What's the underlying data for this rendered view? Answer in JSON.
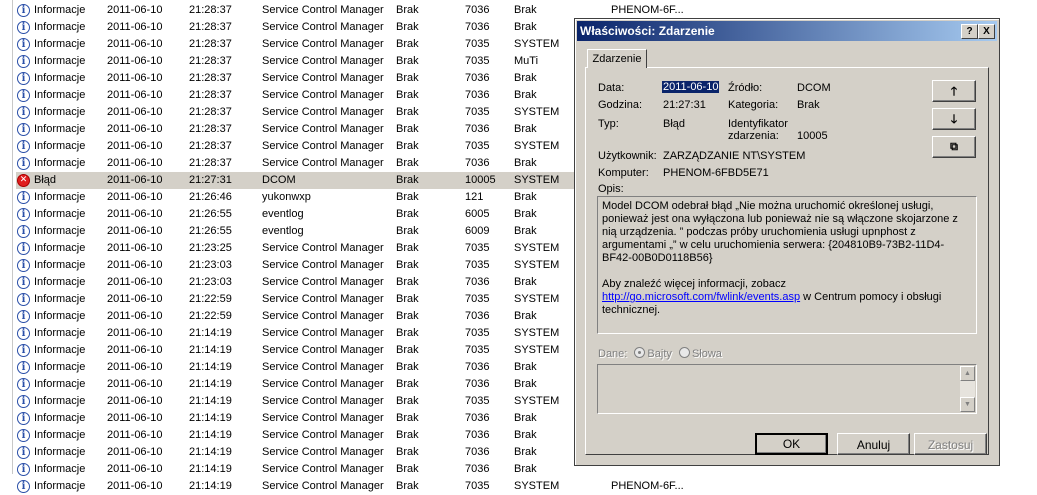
{
  "events": [
    {
      "type": "Informacje",
      "date": "2011-06-10",
      "time": "21:28:37",
      "source": "Service Control Manager",
      "category": "Brak",
      "id": "7036",
      "user": "Brak",
      "computer": "PHENOM-6F...",
      "kind": "info"
    },
    {
      "type": "Informacje",
      "date": "2011-06-10",
      "time": "21:28:37",
      "source": "Service Control Manager",
      "category": "Brak",
      "id": "7036",
      "user": "Brak",
      "computer": "",
      "kind": "info"
    },
    {
      "type": "Informacje",
      "date": "2011-06-10",
      "time": "21:28:37",
      "source": "Service Control Manager",
      "category": "Brak",
      "id": "7035",
      "user": "SYSTEM",
      "computer": "",
      "kind": "info"
    },
    {
      "type": "Informacje",
      "date": "2011-06-10",
      "time": "21:28:37",
      "source": "Service Control Manager",
      "category": "Brak",
      "id": "7035",
      "user": "MuTi",
      "computer": "",
      "kind": "info"
    },
    {
      "type": "Informacje",
      "date": "2011-06-10",
      "time": "21:28:37",
      "source": "Service Control Manager",
      "category": "Brak",
      "id": "7036",
      "user": "Brak",
      "computer": "",
      "kind": "info"
    },
    {
      "type": "Informacje",
      "date": "2011-06-10",
      "time": "21:28:37",
      "source": "Service Control Manager",
      "category": "Brak",
      "id": "7036",
      "user": "Brak",
      "computer": "",
      "kind": "info"
    },
    {
      "type": "Informacje",
      "date": "2011-06-10",
      "time": "21:28:37",
      "source": "Service Control Manager",
      "category": "Brak",
      "id": "7035",
      "user": "SYSTEM",
      "computer": "",
      "kind": "info"
    },
    {
      "type": "Informacje",
      "date": "2011-06-10",
      "time": "21:28:37",
      "source": "Service Control Manager",
      "category": "Brak",
      "id": "7036",
      "user": "Brak",
      "computer": "",
      "kind": "info"
    },
    {
      "type": "Informacje",
      "date": "2011-06-10",
      "time": "21:28:37",
      "source": "Service Control Manager",
      "category": "Brak",
      "id": "7035",
      "user": "SYSTEM",
      "computer": "",
      "kind": "info"
    },
    {
      "type": "Informacje",
      "date": "2011-06-10",
      "time": "21:28:37",
      "source": "Service Control Manager",
      "category": "Brak",
      "id": "7036",
      "user": "Brak",
      "computer": "",
      "kind": "info"
    },
    {
      "type": "Błąd",
      "date": "2011-06-10",
      "time": "21:27:31",
      "source": "DCOM",
      "category": "Brak",
      "id": "10005",
      "user": "SYSTEM",
      "computer": "",
      "kind": "err"
    },
    {
      "type": "Informacje",
      "date": "2011-06-10",
      "time": "21:26:46",
      "source": "yukonwxp",
      "category": "Brak",
      "id": "121",
      "user": "Brak",
      "computer": "",
      "kind": "info"
    },
    {
      "type": "Informacje",
      "date": "2011-06-10",
      "time": "21:26:55",
      "source": "eventlog",
      "category": "Brak",
      "id": "6005",
      "user": "Brak",
      "computer": "",
      "kind": "info"
    },
    {
      "type": "Informacje",
      "date": "2011-06-10",
      "time": "21:26:55",
      "source": "eventlog",
      "category": "Brak",
      "id": "6009",
      "user": "Brak",
      "computer": "",
      "kind": "info"
    },
    {
      "type": "Informacje",
      "date": "2011-06-10",
      "time": "21:23:25",
      "source": "Service Control Manager",
      "category": "Brak",
      "id": "7035",
      "user": "SYSTEM",
      "computer": "",
      "kind": "info"
    },
    {
      "type": "Informacje",
      "date": "2011-06-10",
      "time": "21:23:03",
      "source": "Service Control Manager",
      "category": "Brak",
      "id": "7035",
      "user": "SYSTEM",
      "computer": "",
      "kind": "info"
    },
    {
      "type": "Informacje",
      "date": "2011-06-10",
      "time": "21:23:03",
      "source": "Service Control Manager",
      "category": "Brak",
      "id": "7036",
      "user": "Brak",
      "computer": "",
      "kind": "info"
    },
    {
      "type": "Informacje",
      "date": "2011-06-10",
      "time": "21:22:59",
      "source": "Service Control Manager",
      "category": "Brak",
      "id": "7035",
      "user": "SYSTEM",
      "computer": "",
      "kind": "info"
    },
    {
      "type": "Informacje",
      "date": "2011-06-10",
      "time": "21:22:59",
      "source": "Service Control Manager",
      "category": "Brak",
      "id": "7036",
      "user": "Brak",
      "computer": "",
      "kind": "info"
    },
    {
      "type": "Informacje",
      "date": "2011-06-10",
      "time": "21:14:19",
      "source": "Service Control Manager",
      "category": "Brak",
      "id": "7035",
      "user": "SYSTEM",
      "computer": "",
      "kind": "info"
    },
    {
      "type": "Informacje",
      "date": "2011-06-10",
      "time": "21:14:19",
      "source": "Service Control Manager",
      "category": "Brak",
      "id": "7035",
      "user": "SYSTEM",
      "computer": "",
      "kind": "info"
    },
    {
      "type": "Informacje",
      "date": "2011-06-10",
      "time": "21:14:19",
      "source": "Service Control Manager",
      "category": "Brak",
      "id": "7036",
      "user": "Brak",
      "computer": "",
      "kind": "info"
    },
    {
      "type": "Informacje",
      "date": "2011-06-10",
      "time": "21:14:19",
      "source": "Service Control Manager",
      "category": "Brak",
      "id": "7036",
      "user": "Brak",
      "computer": "",
      "kind": "info"
    },
    {
      "type": "Informacje",
      "date": "2011-06-10",
      "time": "21:14:19",
      "source": "Service Control Manager",
      "category": "Brak",
      "id": "7035",
      "user": "SYSTEM",
      "computer": "",
      "kind": "info"
    },
    {
      "type": "Informacje",
      "date": "2011-06-10",
      "time": "21:14:19",
      "source": "Service Control Manager",
      "category": "Brak",
      "id": "7036",
      "user": "Brak",
      "computer": "",
      "kind": "info"
    },
    {
      "type": "Informacje",
      "date": "2011-06-10",
      "time": "21:14:19",
      "source": "Service Control Manager",
      "category": "Brak",
      "id": "7036",
      "user": "Brak",
      "computer": "",
      "kind": "info"
    },
    {
      "type": "Informacje",
      "date": "2011-06-10",
      "time": "21:14:19",
      "source": "Service Control Manager",
      "category": "Brak",
      "id": "7036",
      "user": "Brak",
      "computer": "",
      "kind": "info"
    },
    {
      "type": "Informacje",
      "date": "2011-06-10",
      "time": "21:14:19",
      "source": "Service Control Manager",
      "category": "Brak",
      "id": "7036",
      "user": "Brak",
      "computer": "",
      "kind": "info"
    },
    {
      "type": "Informacje",
      "date": "2011-06-10",
      "time": "21:14:19",
      "source": "Service Control Manager",
      "category": "Brak",
      "id": "7035",
      "user": "SYSTEM",
      "computer": "PHENOM-6F...",
      "kind": "info"
    }
  ],
  "selected_row": 10,
  "dialog": {
    "title": "Właściwości: Zdarzenie",
    "help_btn": "?",
    "close_btn": "X",
    "tab": "Zdarzenie",
    "data_label": "Data:",
    "data_value": "2011-06-10",
    "source_label": "Źródło:",
    "source_value": "DCOM",
    "time_label": "Godzina:",
    "time_value": "21:27:31",
    "category_label": "Kategoria:",
    "category_value": "Brak",
    "type_label": "Typ:",
    "type_value": "Błąd",
    "event_id_label_1": "Identyfikator",
    "event_id_label_2": "zdarzenia:",
    "event_id_value": "10005",
    "user_label": "Użytkownik:",
    "user_value": "ZARZĄDZANIE NT\\SYSTEM",
    "computer_label": "Komputer:",
    "computer_value": "PHENOM-6FBD5E71",
    "desc_label": "Opis:",
    "desc_text": "Model DCOM odebrał błąd „Nie można uruchomić określonej usługi, ponieważ jest ona wyłączona lub ponieważ nie są włączone skojarzone z nią urządzenia. ” podczas próby uruchomienia usługi upnphost z argumentami „” w celu uruchomienia serwera: {204810B9-73B2-11D4-BF42-00B0D0118B56}",
    "desc_more_pre": "Aby znaleźć więcej informacji, zobacz",
    "desc_link": "http://go.microsoft.com/fwlink/events.asp",
    "desc_more_post": "w Centrum pomocy i obsługi technicznej.",
    "dane_label": "Dane:",
    "bytes_label": "Bajty",
    "words_label": "Słowa",
    "ok": "OK",
    "cancel": "Anuluj",
    "apply": "Zastosuj"
  }
}
